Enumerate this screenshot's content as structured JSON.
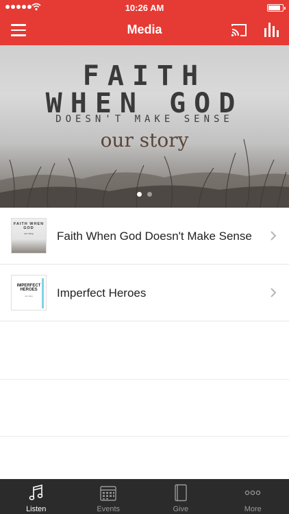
{
  "status_bar": {
    "time": "10:26 AM"
  },
  "nav": {
    "title": "Media",
    "menu_icon": "hamburger-icon",
    "cast_icon": "cast-icon",
    "stats_icon": "bar-chart-icon"
  },
  "hero": {
    "line1": "FAITH",
    "line2": "WHEN GOD",
    "line3": "DOESN'T MAKE SENSE",
    "line4": "our story",
    "slide_count": 2,
    "active_slide": 1
  },
  "list": [
    {
      "label": "Faith When God Doesn't Make Sense",
      "thumb_text": "FAITH WHEN GOD",
      "thumb_sub": "our story"
    },
    {
      "label": "Imperfect Heroes",
      "thumb_text": "IMPERFECT HEROES",
      "thumb_sub": "our story"
    }
  ],
  "tabs": [
    {
      "label": "Listen",
      "icon": "music-note-icon",
      "active": true
    },
    {
      "label": "Events",
      "icon": "calendar-icon",
      "active": false
    },
    {
      "label": "Give",
      "icon": "book-icon",
      "active": false
    },
    {
      "label": "More",
      "icon": "more-dots-icon",
      "active": false
    }
  ],
  "colors": {
    "accent": "#e63a34",
    "tabbar": "#2b2b2b"
  }
}
